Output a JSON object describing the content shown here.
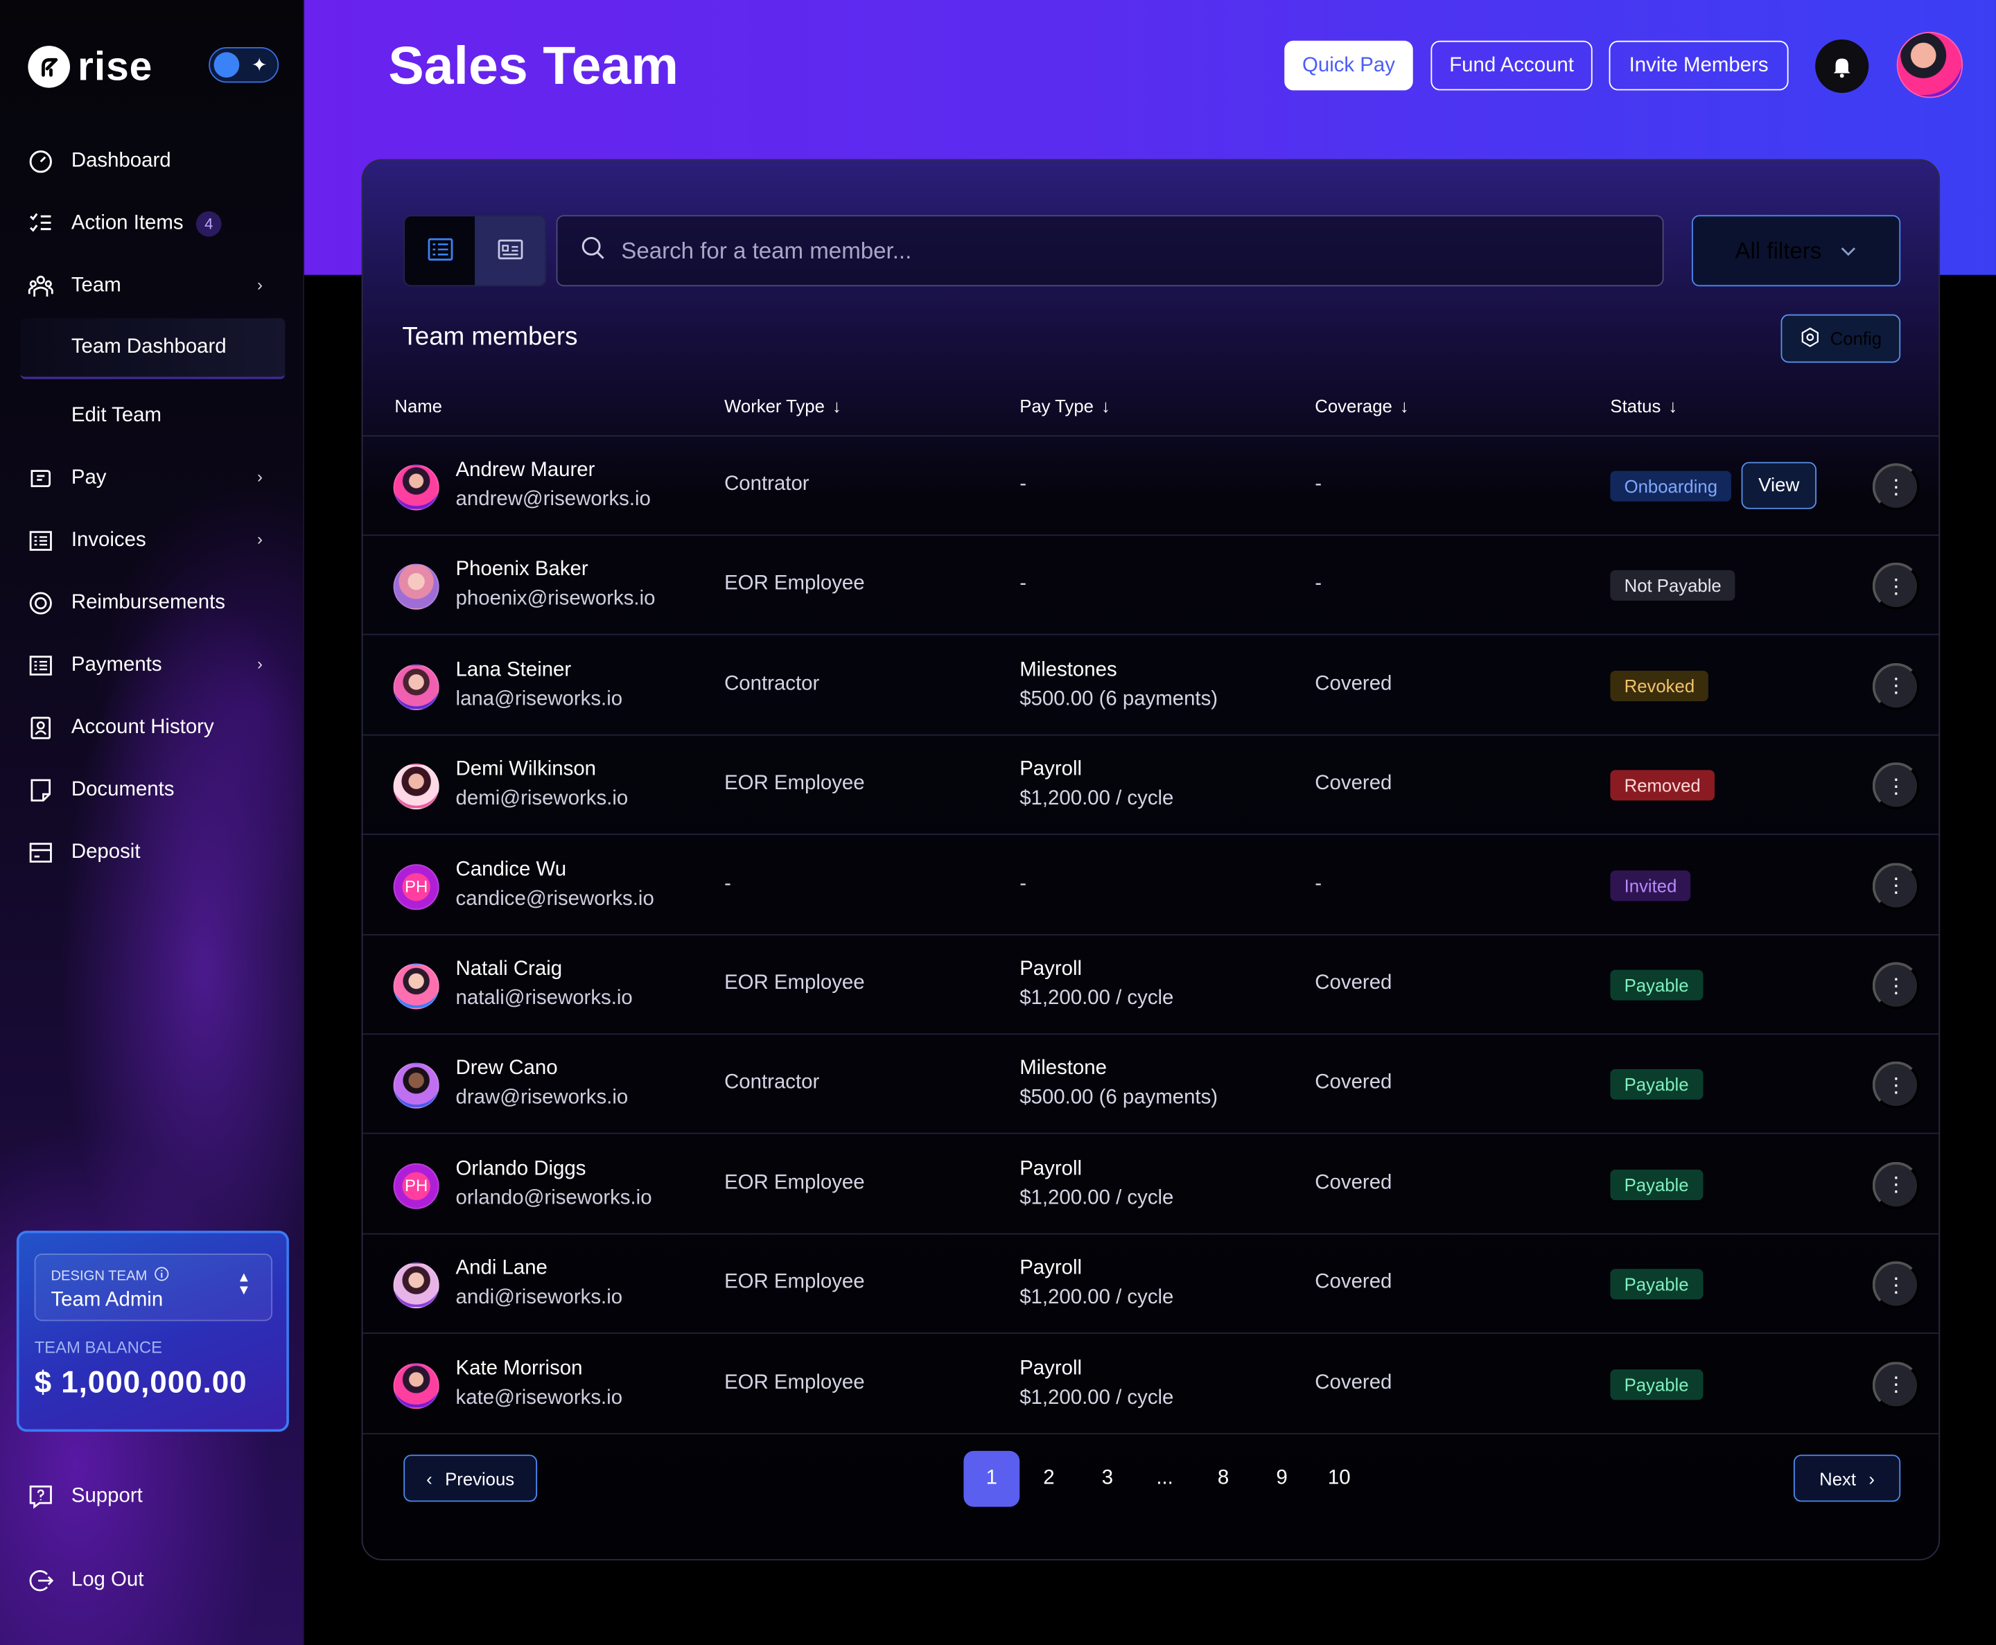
{
  "brand": {
    "name": "rise"
  },
  "sidebar": {
    "items": [
      {
        "label": "Dashboard",
        "icon": "dashboard-icon"
      },
      {
        "label": "Action Items",
        "icon": "checklist-icon",
        "badge": "4"
      },
      {
        "label": "Team",
        "icon": "team-icon"
      },
      {
        "label": "Pay",
        "icon": "pay-icon"
      },
      {
        "label": "Invoices",
        "icon": "invoice-icon"
      },
      {
        "label": "Reimbursements",
        "icon": "reimbursement-icon"
      },
      {
        "label": "Payments",
        "icon": "payments-icon"
      },
      {
        "label": "Account History",
        "icon": "account-history-icon"
      },
      {
        "label": "Documents",
        "icon": "document-icon"
      },
      {
        "label": "Deposit",
        "icon": "deposit-icon"
      }
    ],
    "team_sub": [
      {
        "label": "Team Dashboard"
      },
      {
        "label": "Edit Team"
      }
    ],
    "team_card": {
      "team_label": "DESIGN TEAM",
      "role": "Team Admin",
      "balance_label": "TEAM BALANCE",
      "balance": "$ 1,000,000.00"
    },
    "support": "Support",
    "logout": "Log Out"
  },
  "header": {
    "title": "Sales Team",
    "quick_pay": "Quick Pay",
    "fund_account": "Fund Account",
    "invite_members": "Invite Members"
  },
  "toolbar": {
    "search_placeholder": "Search for a team member...",
    "filters": "All filters",
    "section_title": "Team members",
    "config": "Config"
  },
  "table": {
    "columns": [
      "Name",
      "Worker Type",
      "Pay Type",
      "Coverage",
      "Status"
    ],
    "view_label": "View",
    "rows": [
      {
        "name": "Andrew Maurer",
        "email": "andrew@riseworks.io",
        "worker": "Contrator",
        "pay1": "-",
        "pay2": "",
        "coverage": "-",
        "status": "Onboarding",
        "status_class": "st-onboarding",
        "initials": "",
        "av": "a"
      },
      {
        "name": "Phoenix Baker",
        "email": "phoenix@riseworks.io",
        "worker": "EOR Employee",
        "pay1": "-",
        "pay2": "",
        "coverage": "-",
        "status": "Not Payable",
        "status_class": "st-notpayable",
        "initials": "",
        "av": "b"
      },
      {
        "name": "Lana Steiner",
        "email": "lana@riseworks.io",
        "worker": "Contractor",
        "pay1": "Milestones",
        "pay2": "$500.00 (6 payments)",
        "coverage": "Covered",
        "status": "Revoked",
        "status_class": "st-revoked",
        "initials": "",
        "av": "c"
      },
      {
        "name": "Demi Wilkinson",
        "email": "demi@riseworks.io",
        "worker": "EOR Employee",
        "pay1": "Payroll",
        "pay2": "$1,200.00 / cycle",
        "coverage": "Covered",
        "status": "Removed",
        "status_class": "st-removed",
        "initials": "",
        "av": "d"
      },
      {
        "name": "Candice Wu",
        "email": "candice@riseworks.io",
        "worker": "-",
        "pay1": "-",
        "pay2": "",
        "coverage": "-",
        "status": "Invited",
        "status_class": "st-invited",
        "initials": "PH",
        "av": "e"
      },
      {
        "name": "Natali Craig",
        "email": "natali@riseworks.io",
        "worker": "EOR Employee",
        "pay1": "Payroll",
        "pay2": "$1,200.00 / cycle",
        "coverage": "Covered",
        "status": "Payable",
        "status_class": "st-payable",
        "initials": "",
        "av": "f"
      },
      {
        "name": "Drew Cano",
        "email": "draw@riseworks.io",
        "worker": "Contractor",
        "pay1": "Milestone",
        "pay2": "$500.00 (6 payments)",
        "coverage": "Covered",
        "status": "Payable",
        "status_class": "st-payable",
        "initials": "",
        "av": "g"
      },
      {
        "name": "Orlando Diggs",
        "email": "orlando@riseworks.io",
        "worker": "EOR Employee",
        "pay1": "Payroll",
        "pay2": "$1,200.00 / cycle",
        "coverage": "Covered",
        "status": "Payable",
        "status_class": "st-payable",
        "initials": "PH",
        "av": "e"
      },
      {
        "name": "Andi Lane",
        "email": "andi@riseworks.io",
        "worker": "EOR Employee",
        "pay1": "Payroll",
        "pay2": "$1,200.00 / cycle",
        "coverage": "Covered",
        "status": "Payable",
        "status_class": "st-payable",
        "initials": "",
        "av": "h"
      },
      {
        "name": "Kate Morrison",
        "email": "kate@riseworks.io",
        "worker": "EOR Employee",
        "pay1": "Payroll",
        "pay2": "$1,200.00 / cycle",
        "coverage": "Covered",
        "status": "Payable",
        "status_class": "st-payable",
        "initials": "",
        "av": "a"
      }
    ]
  },
  "pagination": {
    "previous": "Previous",
    "next": "Next",
    "pages": [
      "1",
      "2",
      "3",
      "...",
      "8",
      "9",
      "10"
    ],
    "current": "1"
  },
  "colors": {
    "accent": "#5b5ff0",
    "header_start": "#6a22ee",
    "header_end": "#3b3ff4",
    "payable": "#7ff0c0",
    "removed": "#8a1b22"
  }
}
